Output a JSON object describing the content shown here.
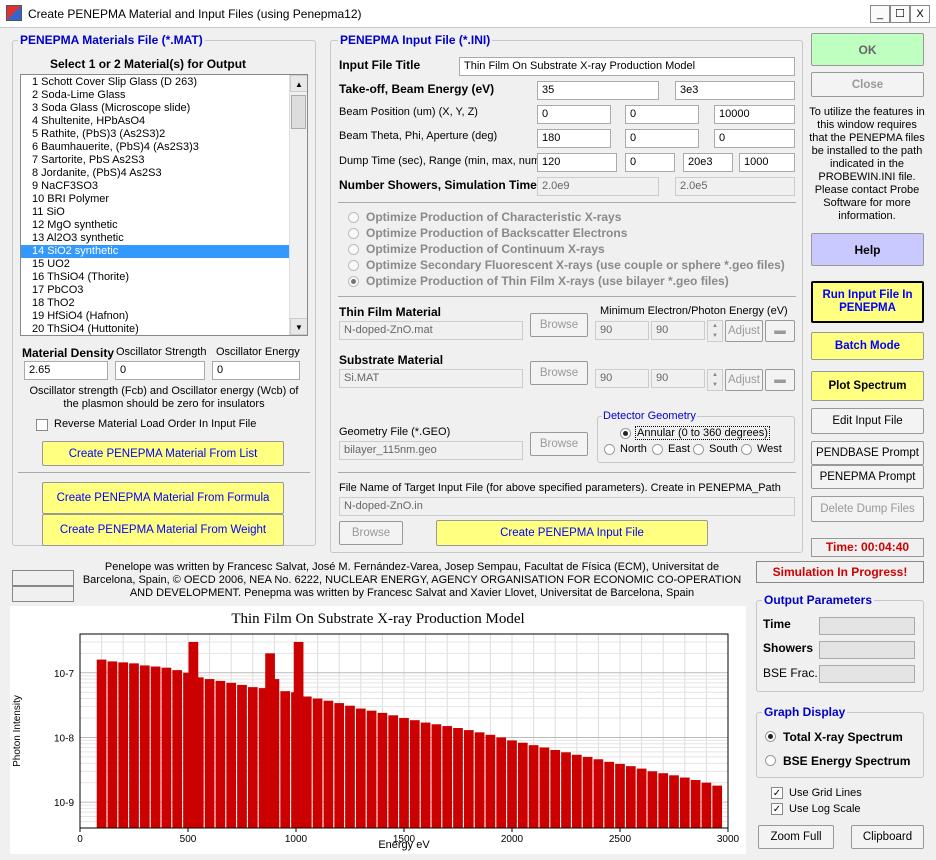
{
  "window": {
    "title": "Create PENEPMA Material and Input Files (using Penepma12)",
    "min": "_",
    "max": "☐",
    "close": "X"
  },
  "materials": {
    "group_title": "PENEPMA Materials File (*.MAT)",
    "select_label": "Select 1 or 2 Material(s) for Output",
    "items": [
      "1 Schott Cover Slip Glass (D 263)",
      "2 Soda-Lime Glass",
      "3 Soda Glass (Microscope slide)",
      "4 Shultenite, HPbAsO4",
      "5 Rathite, (PbS)3 (As2S3)2",
      "6 Baumhauerite, (PbS)4 (As2S3)3",
      "7 Sartorite, PbS As2S3",
      "8 Jordanite, (PbS)4 As2S3",
      "9 NaCF3SO3",
      "10 BRI Polymer",
      "11 SiO",
      "12 MgO synthetic",
      "13 Al2O3 synthetic",
      "14 SiO2 synthetic",
      "15 UO2",
      "16 ThSiO4 (Thorite)",
      "17 PbCO3",
      "18 ThO2",
      "19 HfSiO4 (Hafnon)",
      "20 ThSiO4 (Huttonite)"
    ],
    "selected_index": 13,
    "density_label": "Material Density",
    "density_value": "2.65",
    "osc_strength_label": "Oscillator Strength",
    "osc_strength_value": "0",
    "osc_energy_label": "Oscillator Energy",
    "osc_energy_value": "0",
    "note": "Oscillator strength (Fcb) and Oscillator energy (Wcb) of the plasmon should be zero for insulators",
    "reverse_label": "Reverse Material Load Order In Input File",
    "btn_from_list": "Create PENEPMA Material From List",
    "btn_from_formula": "Create PENEPMA Material From Formula",
    "btn_from_weight": "Create PENEPMA Material From Weight"
  },
  "input": {
    "group_title": "PENEPMA Input File (*.INI)",
    "title_label": "Input File Title",
    "title_value": "Thin Film On Substrate X-ray Production Model",
    "takeoff_label": "Take-off, Beam Energy (eV)",
    "takeoff": "35",
    "beam_energy": "3e3",
    "beampos_label": "Beam Position (um) (X, Y, Z)",
    "pos_x": "0",
    "pos_y": "0",
    "pos_z": "10000",
    "theta_label": "Beam Theta, Phi, Aperture (deg)",
    "theta": "180",
    "phi": "0",
    "aperture": "0",
    "dump_label": "Dump Time (sec), Range (min, max, num)",
    "dump_time": "120",
    "range_min": "0",
    "range_max": "20e3",
    "range_num": "1000",
    "showers_label": "Number Showers, Simulation Time",
    "showers": "2.0e9",
    "sim_time": "2.0e5",
    "options": [
      "Optimize Production of Characteristic X-rays",
      "Optimize Production of Backscatter Electrons",
      "Optimize Production of Continuum X-rays",
      "Optimize Secondary Fluorescent X-rays (use couple or sphere *.geo files)",
      "Optimize Production of Thin Film X-rays (use bilayer *.geo files)"
    ],
    "thin_label": "Thin Film Material",
    "thin_value": "N-doped-ZnO.mat",
    "min_energy_label": "Minimum Electron/Photon Energy (eV)",
    "thin_e1": "90",
    "thin_e2": "90",
    "sub_e1": "90",
    "sub_e2": "90",
    "browse": "Browse",
    "adjust": "Adjust",
    "sub_label": "Substrate Material",
    "sub_value": "Si.MAT",
    "geo_label": "Geometry File (*.GEO)",
    "geo_value": "bilayer_115nm.geo",
    "detector_title": "Detector Geometry",
    "annular": "Annular (0 to 360 degrees)",
    "north": "North",
    "east": "East",
    "south": "South",
    "west": "West",
    "target_label": "File Name of Target Input File (for above specified parameters). Create in PENEPMA_Path",
    "target_value": "N-doped-ZnO.in",
    "btn_create_input": "Create PENEPMA Input File"
  },
  "right": {
    "ok": "OK",
    "close": "Close",
    "info": "To utilize the features in this window requires that the PENEPMA files be installed to the path indicated in the PROBEWIN.INI file. Please contact Probe Software for more information.",
    "help": "Help",
    "run": "Run Input File In PENEPMA",
    "batch": "Batch Mode",
    "plot": "Plot Spectrum",
    "edit": "Edit Input File",
    "pendbase": "PENDBASE Prompt",
    "penepma": "PENEPMA Prompt",
    "delete": "Delete Dump Files",
    "time": "Time: 00:04:40",
    "status": "Simulation In Progress!",
    "out_title": "Output Parameters",
    "out_time": "Time",
    "out_showers": "Showers",
    "out_bse": "BSE Frac.",
    "graph_title": "Graph Display",
    "total": "Total X-ray Spectrum",
    "bse": "BSE Energy Spectrum",
    "grid": "Use Grid Lines",
    "log": "Use Log Scale",
    "zoom": "Zoom Full",
    "clipboard": "Clipboard"
  },
  "credits": "Penelope was written by Francesc Salvat, José M. Fernández-Varea, Josep Sempau, Facultat de Física (ECM), Universitat de Barcelona, Spain, © OECD 2006, NEA No. 6222, NUCLEAR ENERGY, AGENCY ORGANISATION FOR ECONOMIC CO-OPERATION AND DEVELOPMENT. Penepma was written by Francesc Salvat and Xavier Llovet, Universitat de Barcelona, Spain",
  "chart_data": {
    "type": "bar",
    "title": "Thin Film On Substrate X-ray Production Model",
    "xlabel": "Energy eV",
    "ylabel": "Photon Intensity",
    "xlim": [
      0,
      3000
    ],
    "ylog": true,
    "ylim_log10": [
      -9.4,
      -6.4
    ],
    "xticks": [
      0,
      500,
      1000,
      1500,
      2000,
      2500,
      3000
    ],
    "yticks": [
      "10-7",
      "10-8",
      "10-9"
    ],
    "ytick_exps": [
      -7,
      -8,
      -9
    ],
    "grid": true,
    "color": "#cc0000",
    "x": [
      100,
      150,
      200,
      250,
      300,
      350,
      400,
      450,
      500,
      525,
      550,
      600,
      650,
      700,
      750,
      800,
      850,
      880,
      900,
      950,
      1000,
      1012,
      1050,
      1100,
      1150,
      1200,
      1250,
      1300,
      1350,
      1400,
      1450,
      1500,
      1550,
      1600,
      1650,
      1700,
      1750,
      1800,
      1850,
      1900,
      1950,
      2000,
      2050,
      2100,
      2150,
      2200,
      2250,
      2300,
      2350,
      2400,
      2450,
      2500,
      2550,
      2600,
      2650,
      2700,
      2750,
      2800,
      2850,
      2900,
      2950
    ],
    "y": [
      1.6e-07,
      1.5e-07,
      1.45e-07,
      1.4e-07,
      1.3e-07,
      1.25e-07,
      1.2e-07,
      1.1e-07,
      1e-07,
      3e-07,
      8.5e-08,
      8e-08,
      7.5e-08,
      7e-08,
      6.5e-08,
      6e-08,
      5.8e-08,
      2e-07,
      8e-08,
      5.2e-08,
      5e-08,
      3e-07,
      4.3e-08,
      4e-08,
      3.7e-08,
      3.4e-08,
      3.1e-08,
      2.8e-08,
      2.6e-08,
      2.4e-08,
      2.2e-08,
      2e-08,
      1.85e-08,
      1.7e-08,
      1.6e-08,
      1.5e-08,
      1.4e-08,
      1.3e-08,
      1.2e-08,
      1.1e-08,
      1e-08,
      9e-09,
      8.3e-09,
      7.6e-09,
      7e-09,
      6.4e-09,
      5.9e-09,
      5.4e-09,
      5e-09,
      4.6e-09,
      4.2e-09,
      3.9e-09,
      3.6e-09,
      3.3e-09,
      3e-09,
      2.8e-09,
      2.6e-09,
      2.4e-09,
      2.2e-09,
      2e-09,
      1.8e-09
    ]
  }
}
